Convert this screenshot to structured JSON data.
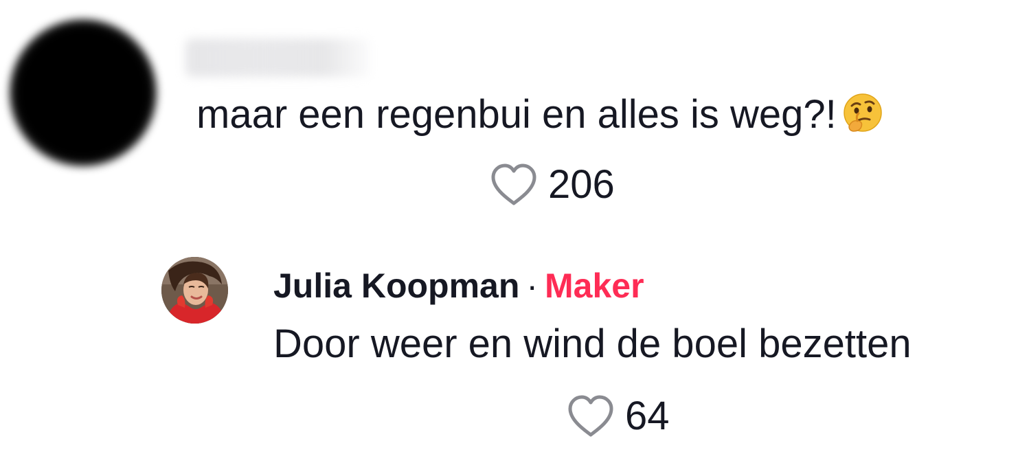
{
  "comment": {
    "username": "",
    "text": "maar een regenbui en alles is weg?!",
    "emoji": "thinking-face-icon",
    "likes": "206"
  },
  "reply": {
    "name": "Julia Koopman",
    "separator": "·",
    "badge": "Maker",
    "text": "Door weer en wind de boel bezetten",
    "likes": "64"
  },
  "colors": {
    "text": "#161823",
    "maker_badge": "#fe2c55",
    "heart_outline": "#8a8b91"
  }
}
